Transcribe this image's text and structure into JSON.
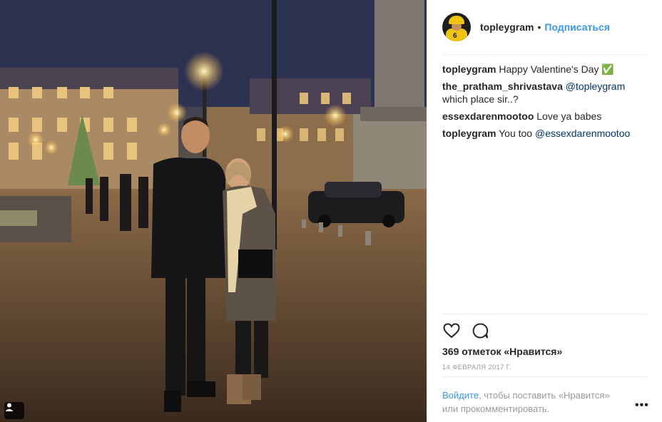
{
  "post": {
    "username": "topleygram",
    "follow_label": "Подписаться",
    "separator": "•",
    "avatar_number": "6"
  },
  "comments": [
    {
      "user": "topleygram",
      "text": "Happy Valentine's Day ✅",
      "mention": ""
    },
    {
      "user": "the_pratham_shrivastava",
      "text_before": "",
      "mention": "@topleygram",
      "text": " which place sir..?"
    },
    {
      "user": "essexdarenmootoo",
      "text": "Love ya babes",
      "mention": ""
    },
    {
      "user": "topleygram",
      "text_before": "You too ",
      "mention": "@essexdarenmootoo",
      "text": ""
    }
  ],
  "likes": "369 отметок «Нравится»",
  "date": "14 февраля 2017 г.",
  "login": {
    "link": "Войдите",
    "rest": ", чтобы поставить «Нравится» или прокомментировать."
  },
  "more_label": "•••",
  "icons": {
    "like": "heart-icon",
    "comment": "comment-icon",
    "tagged": "user-tag-icon",
    "more": "more-options-icon"
  },
  "colors": {
    "link": "#3897f0",
    "mention": "#003569",
    "text": "#262626",
    "muted": "#999999"
  }
}
